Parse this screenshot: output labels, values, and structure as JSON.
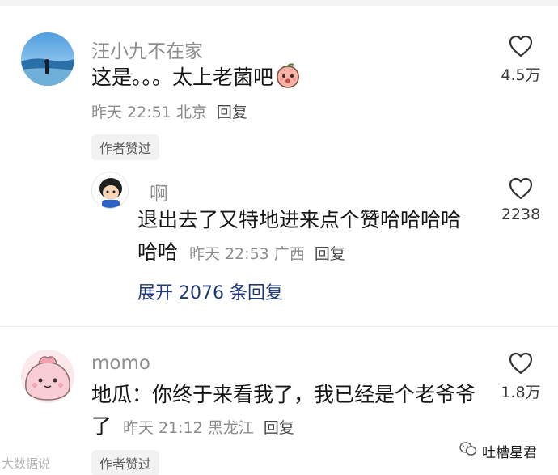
{
  "comments": [
    {
      "username": "汪小九不在家",
      "text": "这是。。。太上老菌吧",
      "emoji": "peach-face-emoji",
      "time": "昨天 22:51",
      "location": "北京",
      "reply_label": "回复",
      "badge": "作者赞过",
      "likes": "4.5万"
    },
    {
      "username": "啊",
      "text_line1": "退出去了又特地进来点个赞哈哈哈哈",
      "text_line2": "哈哈",
      "time": "昨天 22:53",
      "location": "广西",
      "reply_label": "回复",
      "likes": "2238",
      "expand": "展开 2076 条回复"
    },
    {
      "username": "momo",
      "text_line1": "地瓜：你终于来看我了，我已经是个老爷爷",
      "text_line2": "了",
      "time": "昨天 21:12",
      "location": "黑龙江",
      "reply_label": "回复",
      "badge": "作者赞过",
      "likes": "1.8万"
    }
  ],
  "watermark_left": "大数据说",
  "watermark_right": "吐槽星君",
  "colors": {
    "expand_link": "#1f3a78",
    "meta": "#8c8c8c",
    "badge_bg": "#f2f2f2"
  }
}
